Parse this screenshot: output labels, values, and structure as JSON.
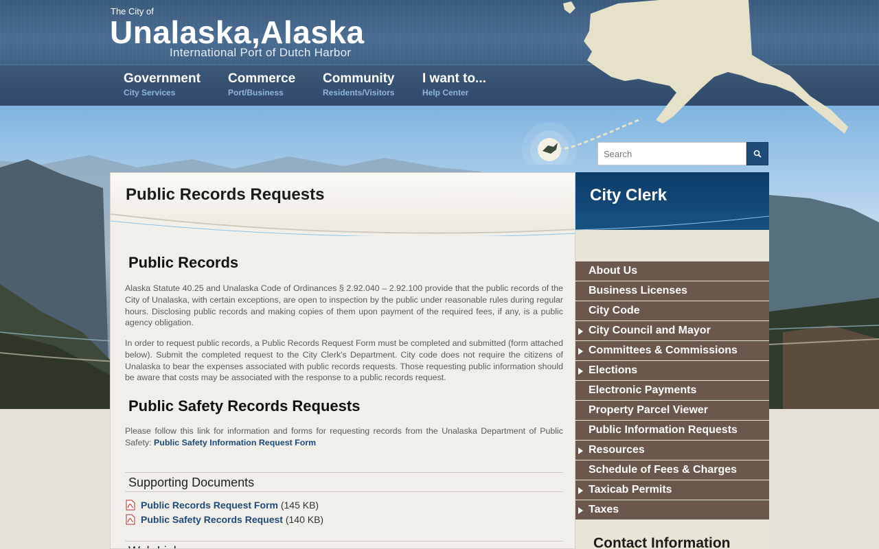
{
  "site": {
    "title_prefix": "The City of",
    "title": "Unalaska,Alaska",
    "tagline": "International Port of Dutch Harbor"
  },
  "nav": {
    "items": [
      {
        "label": "Government",
        "sub": "City Services"
      },
      {
        "label": "Commerce",
        "sub": "Port/Business"
      },
      {
        "label": "Community",
        "sub": "Residents/Visitors"
      },
      {
        "label": "I want to...",
        "sub": "Help Center"
      }
    ]
  },
  "search": {
    "placeholder": "Search",
    "button_icon": "search-icon"
  },
  "page": {
    "title": "Public Records Requests",
    "sections": {
      "public_records": {
        "heading": "Public Records",
        "para1": "Alaska Statute 40.25 and Unalaska Code of Ordinances § 2.92.040 – 2.92.100 provide that the public records of the City of Unalaska, with certain exceptions, are open to inspection by the public under reasonable rules during regular hours. Disclosing public records and making copies of them upon payment of the required fees, if any, is a public agency obligation.",
        "para2": "In order to request public records, a Public Records Request Form must be completed and submitted (form attached below). Submit the completed request to the City Clerk's Department. City code does not require the citizens of Unalaska to bear the expenses associated with public records requests. Those requesting public information should be aware that costs may be associated with the response to a public records request."
      },
      "public_safety": {
        "heading": "Public Safety Records Requests",
        "text": "Please follow this link for information and forms for requesting records from the Unalaska Department of Public Safety: ",
        "link": "Public Safety Information Request Form"
      },
      "supporting_docs": {
        "heading": "Supporting Documents",
        "docs": [
          {
            "name": "Public Records Request Form",
            "size": "(145 KB)"
          },
          {
            "name": "Public Safety Records Request",
            "size": "(140 KB)"
          }
        ]
      },
      "web_links": {
        "heading": "Web Links"
      }
    }
  },
  "sidebar": {
    "title": "City Clerk",
    "items": [
      {
        "label": "About Us",
        "has_children": false
      },
      {
        "label": "Business Licenses",
        "has_children": false
      },
      {
        "label": "City Code",
        "has_children": false
      },
      {
        "label": "City Council and Mayor",
        "has_children": true
      },
      {
        "label": "Committees & Commissions",
        "has_children": true
      },
      {
        "label": "Elections",
        "has_children": true
      },
      {
        "label": "Electronic Payments",
        "has_children": false
      },
      {
        "label": "Property Parcel Viewer",
        "has_children": false
      },
      {
        "label": "Public Information Requests",
        "has_children": false
      },
      {
        "label": "Resources",
        "has_children": true
      },
      {
        "label": "Schedule of Fees & Charges",
        "has_children": false
      },
      {
        "label": "Taxicab Permits",
        "has_children": true
      },
      {
        "label": "Taxes",
        "has_children": true
      }
    ],
    "contact_heading": "Contact Information"
  },
  "colors": {
    "header_blue": "#3f6186",
    "nav_sub": "#8fb4dc",
    "sidebar_item": "#6b574b",
    "link": "#1d4a78",
    "search_button": "#1f4b7a"
  }
}
